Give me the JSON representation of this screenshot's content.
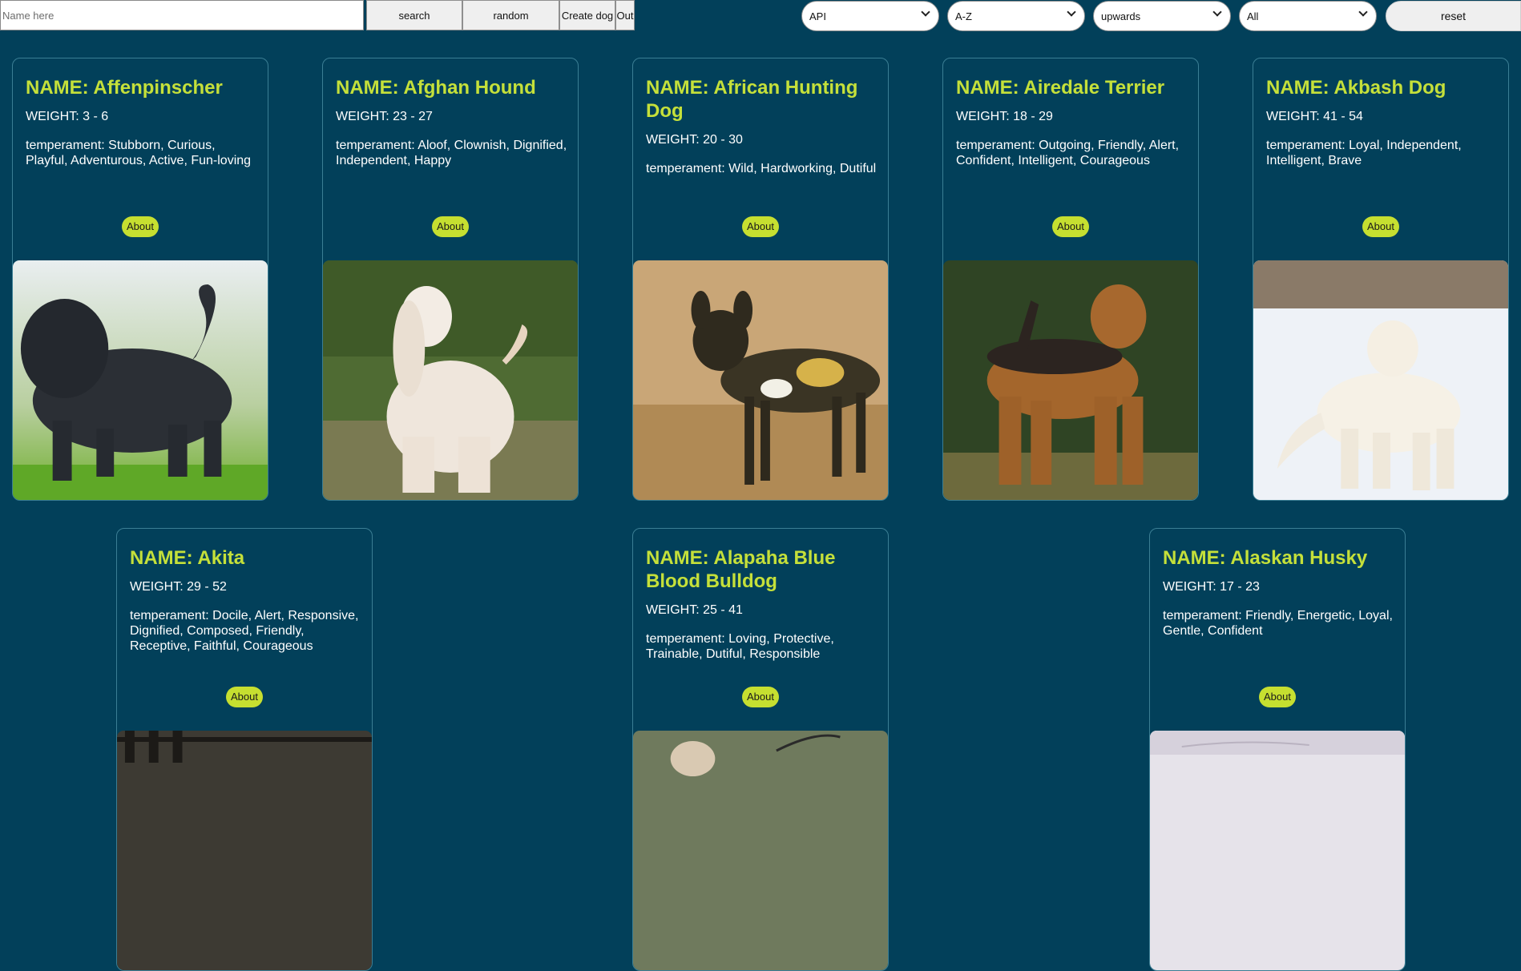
{
  "toolbar": {
    "search_placeholder": "Name here",
    "search_value": "",
    "search_label": "search",
    "random_label": "random",
    "create_label": "Create dog",
    "out_label": "Out",
    "filters": [
      {
        "name": "source-filter",
        "selected": "API"
      },
      {
        "name": "alphabetical-order",
        "selected": "A-Z"
      },
      {
        "name": "weight-order",
        "selected": "upwards"
      },
      {
        "name": "temperament-filter",
        "selected": "All"
      }
    ],
    "reset_label": "reset"
  },
  "cards": [
    {
      "name": "NAME: Affenpinscher",
      "weight": "WEIGHT: 3 - 6",
      "temperament": "temperament: Stubborn, Curious, Playful, Adventurous, Active, Fun-loving",
      "about": "About",
      "image_icon": "affenpinscher-photo"
    },
    {
      "name": "NAME: Afghan Hound",
      "weight": "WEIGHT: 23 - 27",
      "temperament": "temperament: Aloof, Clownish, Dignified, Independent, Happy",
      "about": "About",
      "image_icon": "afghan-hound-photo"
    },
    {
      "name": "NAME: African Hunting Dog",
      "weight": "WEIGHT: 20 - 30",
      "temperament": "temperament: Wild, Hardworking, Dutiful",
      "about": "About",
      "image_icon": "african-hunting-dog-photo"
    },
    {
      "name": "NAME: Airedale Terrier",
      "weight": "WEIGHT: 18 - 29",
      "temperament": "temperament: Outgoing, Friendly, Alert, Confident, Intelligent, Courageous",
      "about": "About",
      "image_icon": "airedale-terrier-photo"
    },
    {
      "name": "NAME: Akbash Dog",
      "weight": "WEIGHT: 41 - 54",
      "temperament": "temperament: Loyal, Independent, Intelligent, Brave",
      "about": "About",
      "image_icon": "akbash-dog-photo"
    },
    {
      "name": "NAME: Akita",
      "weight": "WEIGHT: 29 - 52",
      "temperament": "temperament: Docile, Alert, Responsive, Dignified, Composed, Friendly, Receptive, Faithful, Courageous",
      "about": "About",
      "image_icon": "akita-photo"
    },
    {
      "name": "NAME: Alapaha Blue Blood Bulldog",
      "weight": "WEIGHT: 25 - 41",
      "temperament": "temperament: Loving, Protective, Trainable, Dutiful, Responsible",
      "about": "About",
      "image_icon": "alapaha-bulldog-photo"
    },
    {
      "name": "NAME: Alaskan Husky",
      "weight": "WEIGHT: 17 - 23",
      "temperament": "temperament: Friendly, Energetic, Loyal, Gentle, Confident",
      "about": "About",
      "image_icon": "alaskan-husky-photo"
    }
  ],
  "colors": {
    "background": "#02405a",
    "accent": "#c5e03a",
    "text": "#ffffff",
    "card_border": "#3b7e94"
  }
}
